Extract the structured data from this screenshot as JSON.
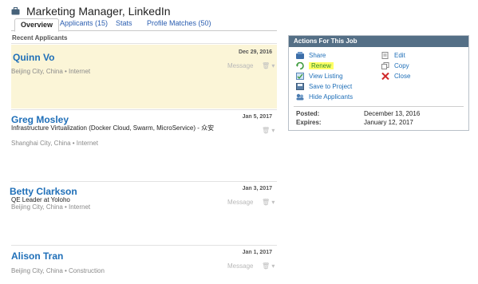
{
  "page_title": "Marketing Manager, LinkedIn",
  "tabs": [
    {
      "label": "Overview"
    },
    {
      "label": "Applicants (15)"
    },
    {
      "label": "Stats"
    },
    {
      "label": "Profile Matches (50)"
    }
  ],
  "section_label": "Recent Applicants",
  "applicants": [
    {
      "name": "Quinn Vo",
      "date": "Dec 29, 2016",
      "headline": "",
      "location": "Beijing City, China • Internet",
      "message_label": "Message",
      "highlighted": true
    },
    {
      "name": "Greg Mosley",
      "date": "Jan 5, 2017",
      "headline": "Infrastructure Virtualization (Docker Cloud, Swarm, MicroService) - 众安",
      "location": "Shanghai City, China • Internet",
      "message_label": "",
      "highlighted": false
    },
    {
      "name": "Betty Clarkson",
      "date": "Jan 3, 2017",
      "headline": "QE Leader at Yoloho",
      "location": "Beijing City, China • Internet",
      "message_label": "Message",
      "highlighted": false
    },
    {
      "name": "Alison Tran",
      "date": "Jan 1, 2017",
      "headline": "",
      "location": "Beijing City, China • Construction",
      "message_label": "Message",
      "highlighted": false
    }
  ],
  "trash_glyph": "🗑 ▾",
  "actions_panel": {
    "title": "Actions For This Job",
    "actions": [
      {
        "label": "Share",
        "icon": "share-icon"
      },
      {
        "label": "Edit",
        "icon": "edit-icon"
      },
      {
        "label": "Renew",
        "icon": "renew-icon"
      },
      {
        "label": "Copy",
        "icon": "copy-icon"
      },
      {
        "label": "View Listing",
        "icon": "view-listing-icon"
      },
      {
        "label": "Close",
        "icon": "close-icon"
      },
      {
        "label": "Save to Project",
        "icon": "save-icon"
      },
      {
        "label": "Hide Applicants",
        "icon": "hide-icon"
      }
    ],
    "posted_label": "Posted:",
    "posted_value": "December 13, 2016",
    "expires_label": "Expires:",
    "expires_value": "January 12, 2017"
  },
  "colors": {
    "link": "#1f6fb8",
    "highlight": "#fbf5d7",
    "panel_header": "#546f86"
  }
}
